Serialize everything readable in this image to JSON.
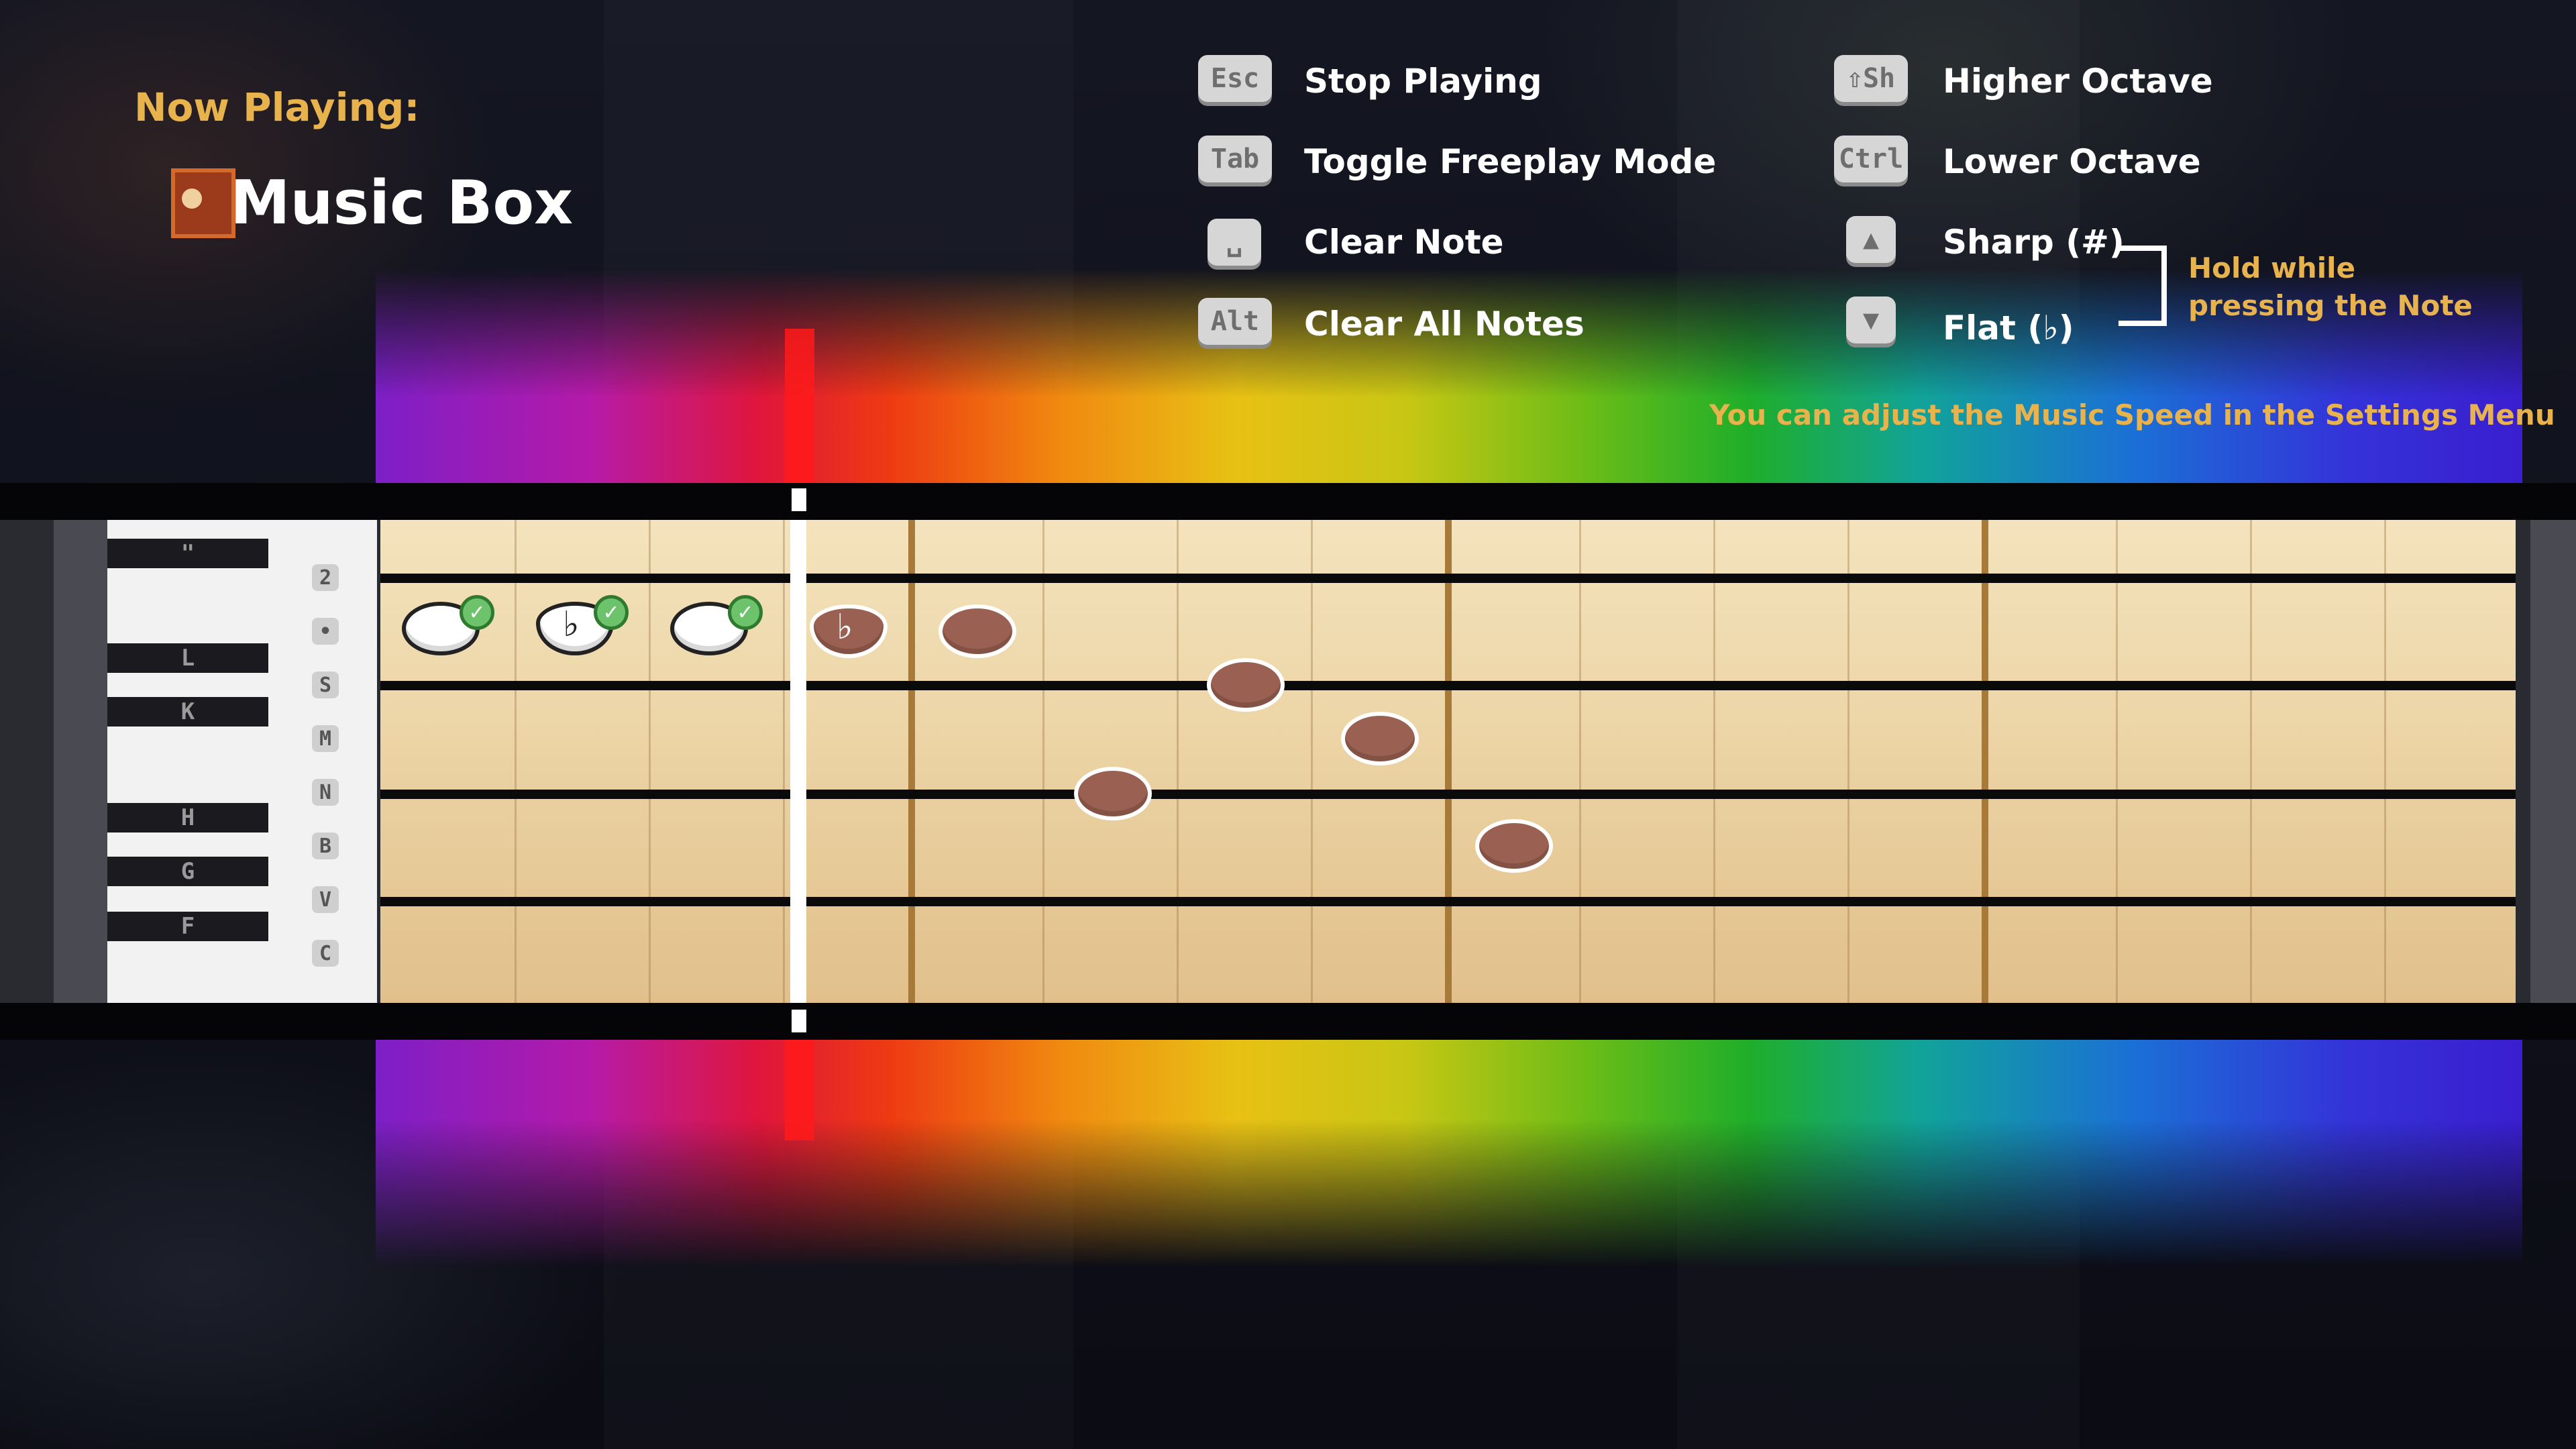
{
  "header": {
    "now_playing_label": "Now Playing:",
    "instrument_name": "Music Box",
    "instrument_icon": "music-box-icon"
  },
  "controls": {
    "stop": {
      "key": "Esc",
      "label": "Stop Playing"
    },
    "freeplay": {
      "key": "Tab",
      "label": "Toggle Freeplay Mode"
    },
    "clear_note": {
      "key": "␣",
      "label": "Clear Note"
    },
    "clear_all": {
      "key": "Alt",
      "label": "Clear All Notes"
    },
    "higher": {
      "key": "⇧Sh",
      "label": "Higher Octave"
    },
    "lower": {
      "key": "Ctrl",
      "label": "Lower Octave"
    },
    "sharp": {
      "key": "▲",
      "label": "Sharp (#)"
    },
    "flat": {
      "key": "▼",
      "label": "Flat (♭)"
    },
    "hold_hint": "Hold while pressing the Note",
    "speed_hint": "You can adjust the Music Speed in the Settings Menu"
  },
  "piano": {
    "black_keys": [
      "\"",
      "L",
      "K",
      "H",
      "G",
      "F"
    ],
    "white_keys": [
      "2",
      "•",
      "S",
      "M",
      "N",
      "B",
      "V",
      "C"
    ]
  },
  "notes": {
    "flat_symbol": "♭"
  },
  "colors": {
    "accent": "#e8b24c",
    "note": "#9a6152",
    "playhead_red": "#ff1a1a"
  }
}
